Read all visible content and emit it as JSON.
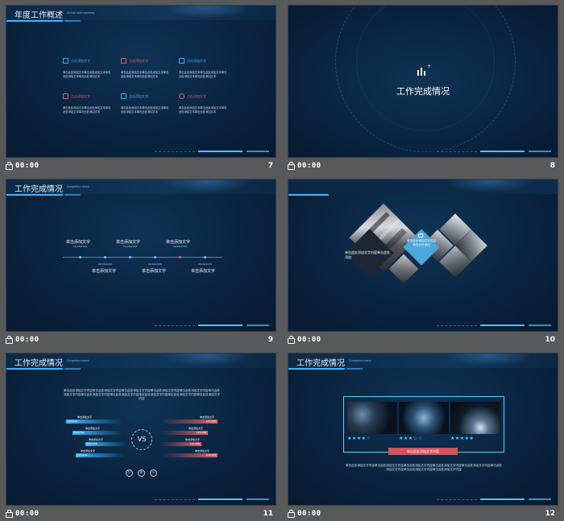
{
  "slides": [
    {
      "number": "7",
      "time": "00:00",
      "title": "年度工作概述",
      "subtitle": "Annual work summary",
      "features": [
        {
          "label": "点击添加文字",
          "color": "#3fb6ff",
          "icon": "bag-icon",
          "body": "单击此处添加文本单击此处添加文本单击此处添加文本单击此处添加文本"
        },
        {
          "label": "点击添加文字",
          "color": "#e0606a",
          "icon": "calendar-icon",
          "body": "单击此处添加文本单击此处添加文本单击此处添加文本单击此处添加文本"
        },
        {
          "label": "点击添加文字",
          "color": "#3fb6ff",
          "icon": "grid-icon",
          "body": "单击此处添加文本单击此处添加文本单击此处添加文本单击此处添加文本"
        },
        {
          "label": "点击添加文字",
          "color": "#e0606a",
          "icon": "share-icon",
          "body": "单击此处添加文本单击此处添加文本单击此处添加文本单击此处添加文本"
        },
        {
          "label": "点击添加文字",
          "color": "#3fb6ff",
          "icon": "building-icon",
          "body": "单击此处添加文本单击此处添加文本单击此处添加文本单击此处添加文本"
        },
        {
          "label": "点击添加文字",
          "color": "#e0606a",
          "icon": "gear-icon",
          "body": "单击此处添加文本单击此处添加文本单击此处添加文本单击此处添加文本"
        }
      ]
    },
    {
      "number": "8",
      "time": "00:00",
      "title": "工作完成情况"
    },
    {
      "number": "9",
      "time": "00:00",
      "title": "工作完成情况",
      "subtitle": "Completion check",
      "timeline": [
        {
          "label": "单击添加文字",
          "date": "06/06/2030",
          "pos": "top"
        },
        {
          "label": "单击添加文字",
          "date": "06/06/2030",
          "pos": "bottom"
        },
        {
          "label": "单击添加文字",
          "date": "06/06/2030",
          "pos": "top"
        },
        {
          "label": "单击添加文字",
          "date": "06/06/2030",
          "pos": "bottom"
        },
        {
          "label": "单击添加文字",
          "date": "06/06/2030",
          "pos": "top"
        },
        {
          "label": "单击添加文字",
          "date": "06/06/2030",
          "pos": "bottom"
        }
      ]
    },
    {
      "number": "10",
      "time": "00:00",
      "text_left": "单击此处添加文字内容单击此处添加",
      "text_right": "单击此处添加文字内容单击此处添加"
    },
    {
      "number": "11",
      "time": "00:00",
      "title": "工作完成情况",
      "subtitle": "Completion check",
      "paragraph": "单击此处添加文字内容单击此处添加文字内容单击此处添加文字内容单击此处添加文字内容单击此处添加文字内容单击此处添加文字内容单击此处添加文字内容单击此处添加文字内容单击此处添加文字内容单击此处添加文字内容单击此处添加文字内容",
      "vs": "VS",
      "left_bars": [
        {
          "label": "单击添加文字",
          "value": "123,456"
        },
        {
          "label": "单击添加文字",
          "value": "123,456"
        },
        {
          "label": "单击添加文字",
          "value": "123,456"
        },
        {
          "label": "单击添加文字",
          "value": "123,456"
        }
      ],
      "right_bars": [
        {
          "label": "单击添加文字",
          "value": "123,456"
        },
        {
          "label": "单击添加文字",
          "value": "123,456"
        },
        {
          "label": "单击添加文字",
          "value": "123,456"
        },
        {
          "label": "单击添加文字",
          "value": "123,456"
        }
      ]
    },
    {
      "number": "12",
      "time": "00:00",
      "title": "工作完成情况",
      "subtitle": "Completion check",
      "ratings": [
        "★★★★☆",
        "★★★☆☆",
        "★★★★★"
      ],
      "caption": "单击此处添加文字内容",
      "paragraph": "单击此处添加文字内容单击此处添加文字内容单击此处添加文字内容单击此处添加文字内容单击此处添加文字内容单击此处添加文字内容单击此处添加文字内容单击此处添加文字内容"
    }
  ],
  "colors": {
    "accent": "#3fb6ff",
    "red": "#e0606a",
    "background": "#58595b",
    "slide": "#0a2440"
  }
}
